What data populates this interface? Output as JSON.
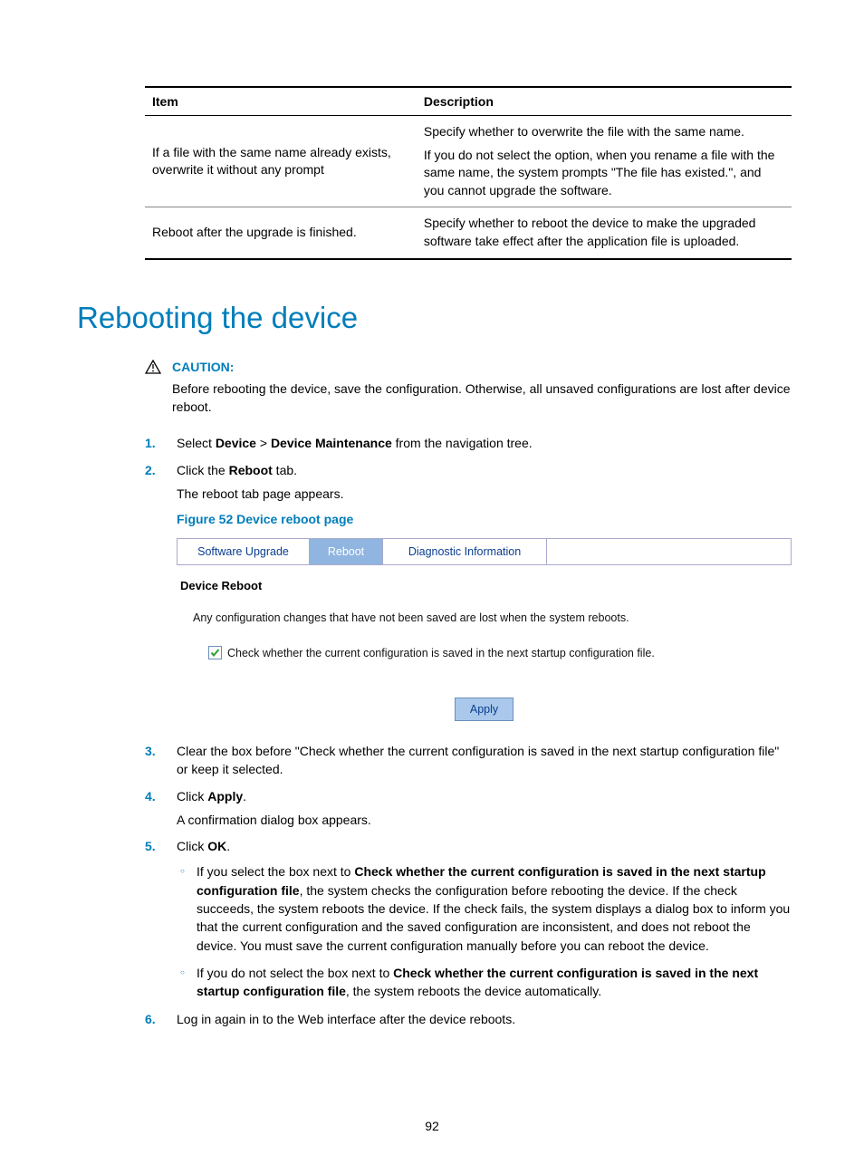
{
  "table": {
    "headers": {
      "item": "Item",
      "description": "Description"
    },
    "rows": [
      {
        "item": "If a file with the same name already exists, overwrite it without any prompt",
        "desc_p1": "Specify whether to overwrite the file with the same name.",
        "desc_p2": "If you do not select the option, when you rename a file with the same name, the system prompts \"The file has existed.\", and you cannot upgrade the software."
      },
      {
        "item": "Reboot after the upgrade is finished.",
        "desc_p1": "Specify whether to reboot the device to make the upgraded software take effect after the application file is uploaded."
      }
    ]
  },
  "section_title": "Rebooting the device",
  "caution": {
    "label": "CAUTION:",
    "text": "Before rebooting the device, save the configuration. Otherwise, all unsaved configurations are lost after device reboot."
  },
  "steps": {
    "s1": {
      "pre": "Select ",
      "b1": "Device",
      "mid": " > ",
      "b2": "Device Maintenance",
      "post": " from the navigation tree."
    },
    "s2": {
      "pre": "Click the ",
      "b": "Reboot",
      "post": " tab.",
      "after": "The reboot tab page appears.",
      "figure_title": "Figure 52 Device reboot page"
    },
    "figure_ui": {
      "tabs": {
        "t1": "Software Upgrade",
        "t2": "Reboot",
        "t3": "Diagnostic Information"
      },
      "section_title": "Device Reboot",
      "warning": "Any configuration changes that have not been saved are lost when the system reboots.",
      "checkbox_label": "Check whether the current configuration is saved in the next startup configuration file.",
      "apply": "Apply"
    },
    "s3": "Clear the box before \"Check whether the current configuration is saved in the next startup configuration file\" or keep it selected.",
    "s4": {
      "pre": "Click ",
      "b": "Apply",
      "post": ".",
      "after": "A confirmation dialog box appears."
    },
    "s5": {
      "pre": "Click ",
      "b": "OK",
      "post": ".",
      "sub1": {
        "pre": "If you select the box next to ",
        "b": "Check whether the current configuration is saved in the next startup configuration file",
        "post": ", the system checks the configuration before rebooting the device. If the check succeeds, the system reboots the device. If the check fails, the system displays a dialog box to inform you that the current configuration and the saved configuration are inconsistent, and does not reboot the device. You must save the current configuration manually before you can reboot the device."
      },
      "sub2": {
        "pre": "If you do not select the box next to ",
        "b": "Check whether the current configuration is saved in the next startup configuration file",
        "post": ", the system reboots the device automatically."
      }
    },
    "s6": "Log in again in to the Web interface after the device reboots."
  },
  "page_number": "92"
}
